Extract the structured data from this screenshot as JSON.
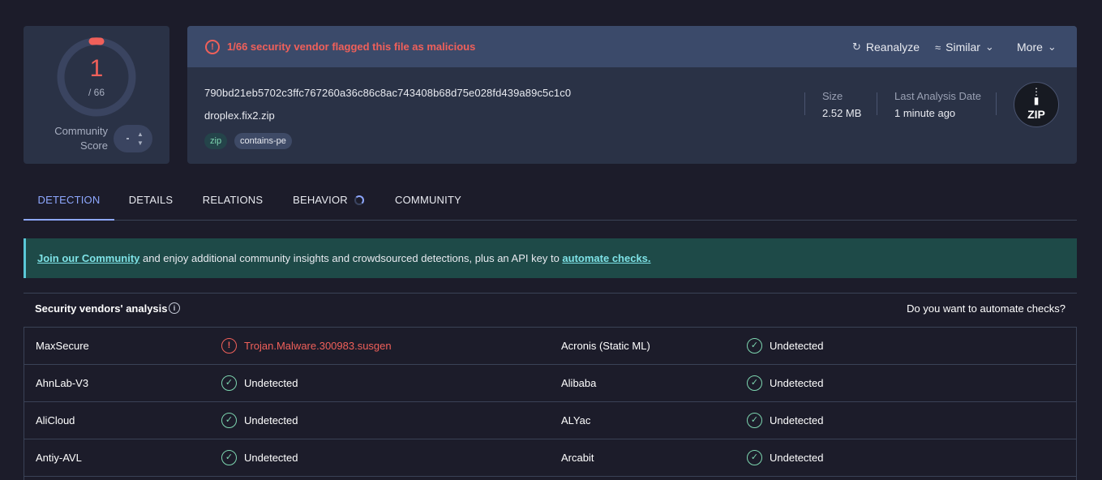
{
  "score": {
    "detections": "1",
    "total": "/ 66",
    "community_label_line1": "Community",
    "community_label_line2": "Score",
    "flagged_fraction": 0.0152
  },
  "alert": {
    "text": "1/66 security vendor flagged this file as malicious",
    "actions": {
      "reanalyze": "Reanalyze",
      "similar": "Similar",
      "more": "More"
    }
  },
  "file": {
    "hash": "790bd21eb5702c3ffc767260a36c86c8ac743408b68d75e028fd439a89c5c1c0",
    "name": "droplex.fix2.zip",
    "tags": [
      "zip",
      "contains-pe"
    ],
    "size_label": "Size",
    "size_value": "2.52 MB",
    "date_label": "Last Analysis Date",
    "date_value": "1 minute ago",
    "type_badge": "ZIP"
  },
  "tabs": [
    "DETECTION",
    "DETAILS",
    "RELATIONS",
    "BEHAVIOR",
    "COMMUNITY"
  ],
  "banner": {
    "link1": "Join our Community",
    "middle": " and enjoy additional community insights and crowdsourced detections, plus an API key to ",
    "link2": "automate checks."
  },
  "vendors": {
    "title": "Security vendors' analysis",
    "cta": "Do you want to automate checks?",
    "rows": [
      [
        {
          "name": "MaxSecure",
          "result": "Trojan.Malware.300983.susgen",
          "status": "malicious"
        },
        {
          "name": "Acronis (Static ML)",
          "result": "Undetected",
          "status": "clean"
        }
      ],
      [
        {
          "name": "AhnLab-V3",
          "result": "Undetected",
          "status": "clean"
        },
        {
          "name": "Alibaba",
          "result": "Undetected",
          "status": "clean"
        }
      ],
      [
        {
          "name": "AliCloud",
          "result": "Undetected",
          "status": "clean"
        },
        {
          "name": "ALYac",
          "result": "Undetected",
          "status": "clean"
        }
      ],
      [
        {
          "name": "Antiy-AVL",
          "result": "Undetected",
          "status": "clean"
        },
        {
          "name": "Arcabit",
          "result": "Undetected",
          "status": "clean"
        }
      ]
    ]
  },
  "colors": {
    "malicious": "#f0605a",
    "clean": "#7dd6b0",
    "accent": "#8ea8ff"
  }
}
